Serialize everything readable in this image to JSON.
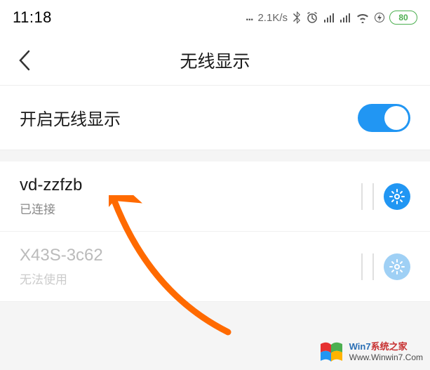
{
  "status_bar": {
    "time": "11:18",
    "network_speed": "2.1K/s",
    "battery_percent": "80"
  },
  "header": {
    "title": "无线显示"
  },
  "enable_row": {
    "label": "开启无线显示",
    "enabled": true
  },
  "devices": [
    {
      "name": "vd-zzfzb",
      "status": "已连接",
      "disabled": false
    },
    {
      "name": "X43S-3c62",
      "status": "无法使用",
      "disabled": true
    }
  ],
  "watermark": {
    "brand_prefix": "Win7",
    "brand_suffix": "系统之家",
    "url": "Www.Winwin7.Com"
  },
  "colors": {
    "accent": "#2196F3",
    "battery": "#4CAF50",
    "arrow": "#FF6A00"
  }
}
